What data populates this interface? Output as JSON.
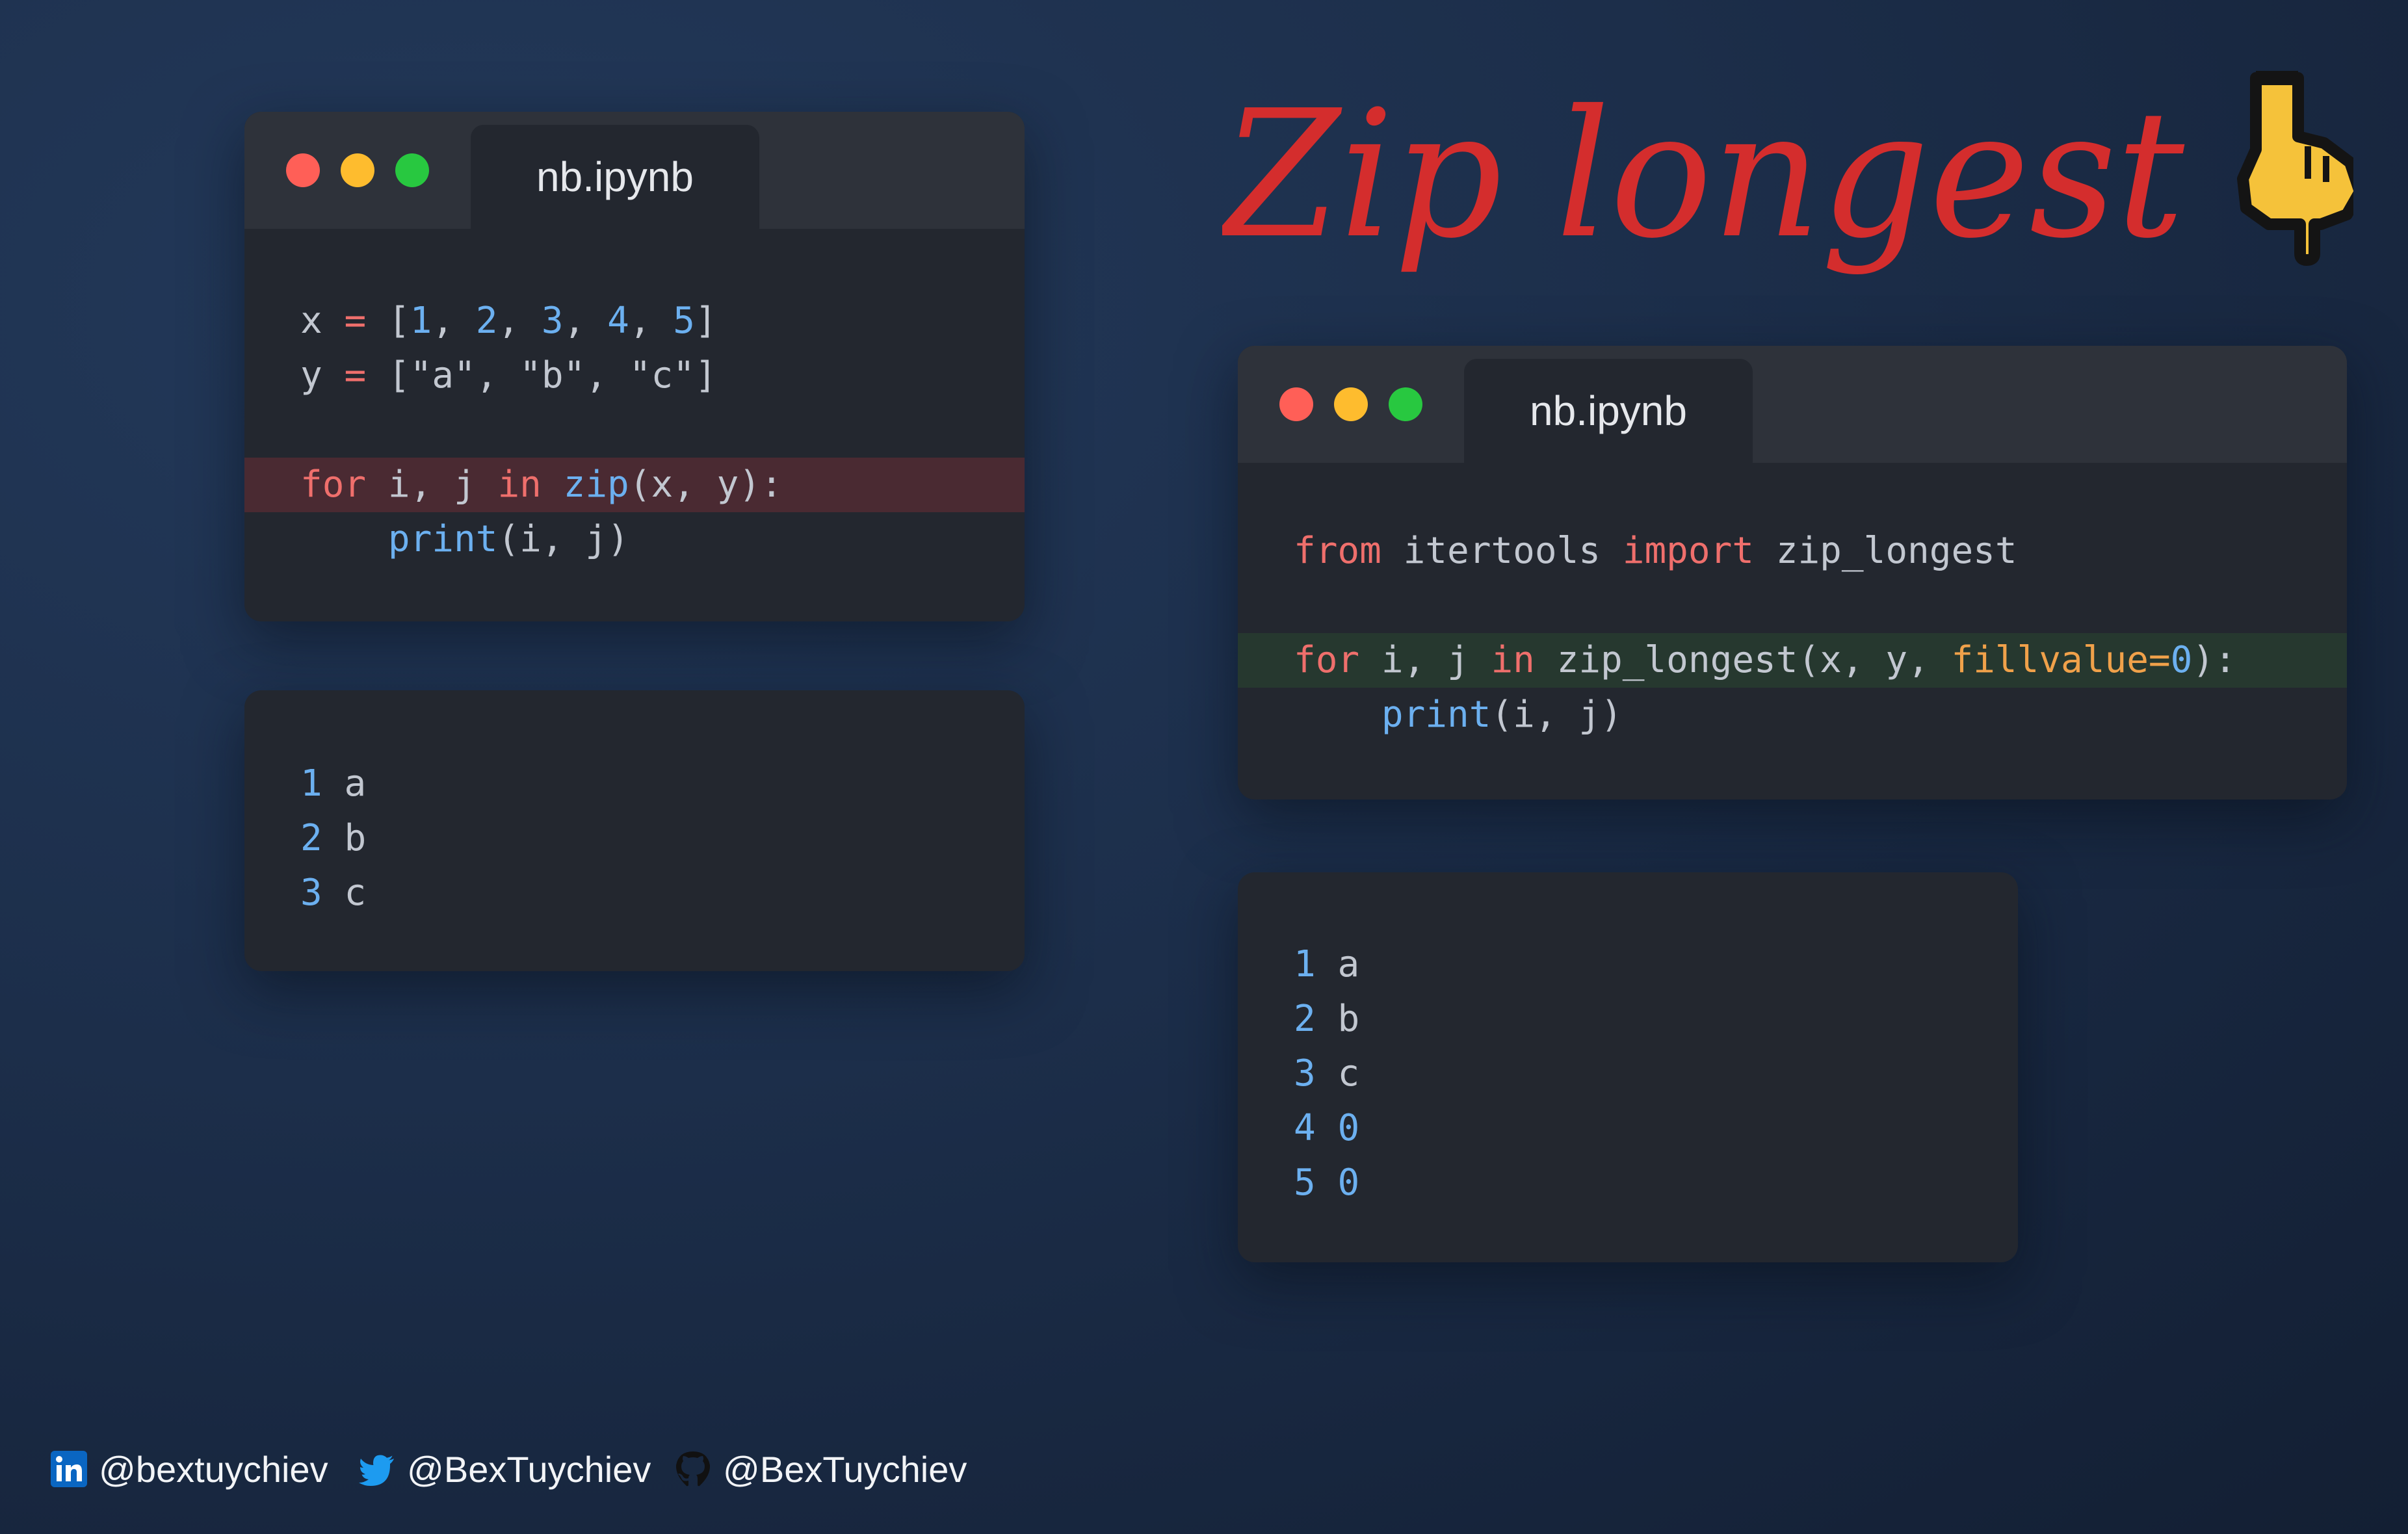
{
  "title": "Zip longest",
  "left_editor": {
    "tab": "nb.ipynb",
    "lines": [
      [
        [
          "x ",
          "plain"
        ],
        [
          "= ",
          "op"
        ],
        [
          "[",
          "plain"
        ],
        [
          "1",
          "num"
        ],
        [
          ", ",
          "plain"
        ],
        [
          "2",
          "num"
        ],
        [
          ", ",
          "plain"
        ],
        [
          "3",
          "num"
        ],
        [
          ", ",
          "plain"
        ],
        [
          "4",
          "num"
        ],
        [
          ", ",
          "plain"
        ],
        [
          "5",
          "num"
        ],
        [
          "]",
          "plain"
        ]
      ],
      [
        [
          "y ",
          "plain"
        ],
        [
          "= ",
          "op"
        ],
        [
          "[\"a\", \"b\", \"c\"]",
          "str"
        ]
      ],
      [],
      [
        [
          "for",
          "kw"
        ],
        [
          " i, j ",
          "plain"
        ],
        [
          "in",
          "kw"
        ],
        [
          " ",
          "plain"
        ],
        [
          "zip",
          "fn"
        ],
        [
          "(x, y):",
          "plain"
        ]
      ],
      [
        [
          "    ",
          "plain"
        ],
        [
          "print",
          "fn"
        ],
        [
          "(i, j)",
          "plain"
        ]
      ]
    ],
    "highlight_line": 3
  },
  "left_output": {
    "rows": [
      [
        "1",
        "a"
      ],
      [
        "2",
        "b"
      ],
      [
        "3",
        "c"
      ]
    ]
  },
  "right_editor": {
    "tab": "nb.ipynb",
    "lines": [
      [
        [
          "from",
          "kw"
        ],
        [
          " itertools ",
          "plain"
        ],
        [
          "import",
          "kw"
        ],
        [
          " zip_longest",
          "plain"
        ]
      ],
      [],
      [
        [
          "for",
          "kw"
        ],
        [
          " i, j ",
          "plain"
        ],
        [
          "in",
          "kw"
        ],
        [
          " zip_longest(x, y, ",
          "plain"
        ],
        [
          "fillvalue=",
          "arg"
        ],
        [
          "0",
          "num"
        ],
        [
          "):",
          "plain"
        ]
      ],
      [
        [
          "    ",
          "plain"
        ],
        [
          "print",
          "fn"
        ],
        [
          "(i, j)",
          "plain"
        ]
      ]
    ],
    "highlight_line": 2
  },
  "right_output": {
    "rows": [
      [
        "1",
        "a"
      ],
      [
        "2",
        "b"
      ],
      [
        "3",
        "c"
      ],
      [
        "4",
        "0"
      ],
      [
        "5",
        "0"
      ]
    ]
  },
  "footer": {
    "linkedin": "@bextuychiev",
    "twitter": "@BexTuychiev",
    "github": "@BexTuychiev"
  },
  "colors": {
    "title": "#d42d2d",
    "keyword": "#ef6f6c",
    "function": "#6cb0f0",
    "argument": "#f0a14a"
  }
}
